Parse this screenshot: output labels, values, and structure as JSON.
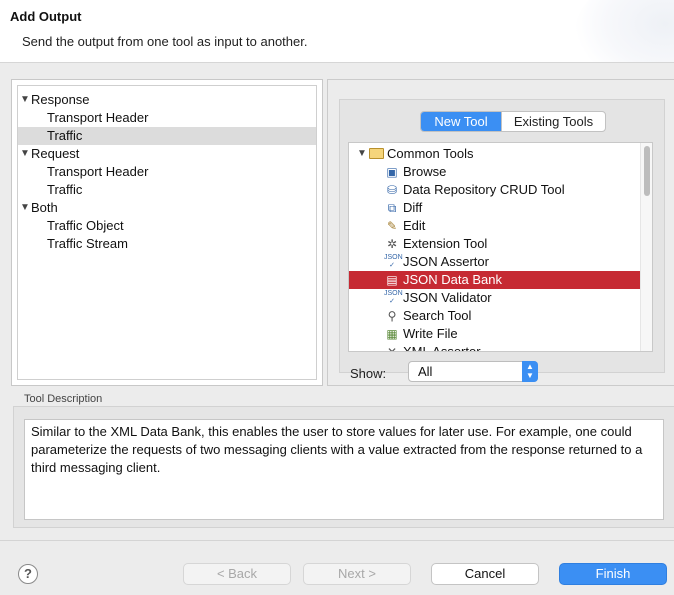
{
  "header": {
    "title": "Add Output",
    "subtitle": "Send the output from one tool as input to another."
  },
  "tree": {
    "items": [
      {
        "label": "Response",
        "expanded": true,
        "level": 0
      },
      {
        "label": "Transport Header",
        "level": 1
      },
      {
        "label": "Traffic",
        "level": 1,
        "selected": true
      },
      {
        "label": "Request",
        "expanded": true,
        "level": 0
      },
      {
        "label": "Transport Header",
        "level": 1
      },
      {
        "label": "Traffic",
        "level": 1
      },
      {
        "label": "Both",
        "expanded": true,
        "level": 0
      },
      {
        "label": "Traffic Object",
        "level": 1
      },
      {
        "label": "Traffic Stream",
        "level": 1
      }
    ]
  },
  "tabs": {
    "new_tool": "New Tool",
    "existing_tools": "Existing Tools",
    "active": "New Tool"
  },
  "tools": {
    "group": "Common Tools",
    "items": [
      {
        "label": "Browse",
        "icon": "browse-icon"
      },
      {
        "label": "Data Repository CRUD Tool",
        "icon": "data-repository-icon"
      },
      {
        "label": "Diff",
        "icon": "diff-icon"
      },
      {
        "label": "Edit",
        "icon": "edit-icon"
      },
      {
        "label": "Extension Tool",
        "icon": "extension-icon"
      },
      {
        "label": "JSON Assertor",
        "icon": "json-assertor-icon"
      },
      {
        "label": "JSON Data Bank",
        "icon": "json-data-bank-icon",
        "selected": true
      },
      {
        "label": "JSON Validator",
        "icon": "json-validator-icon"
      },
      {
        "label": "Search Tool",
        "icon": "search-icon"
      },
      {
        "label": "Write File",
        "icon": "write-file-icon"
      },
      {
        "label": "XML Assertor",
        "icon": "xml-assertor-icon"
      }
    ]
  },
  "show": {
    "label": "Show:",
    "value": "All"
  },
  "description": {
    "label": "Tool Description",
    "text": "Similar to the XML Data Bank, this enables the user to store values for later use. For example, one could parameterize the requests of two messaging clients with a value extracted from the response returned to a third messaging client."
  },
  "buttons": {
    "back": "< Back",
    "next": "Next >",
    "cancel": "Cancel",
    "finish": "Finish",
    "help": "?"
  },
  "colors": {
    "accent": "#3b8ff3",
    "selection_red": "#c62a33",
    "tree_selection": "#dcdcdc"
  }
}
